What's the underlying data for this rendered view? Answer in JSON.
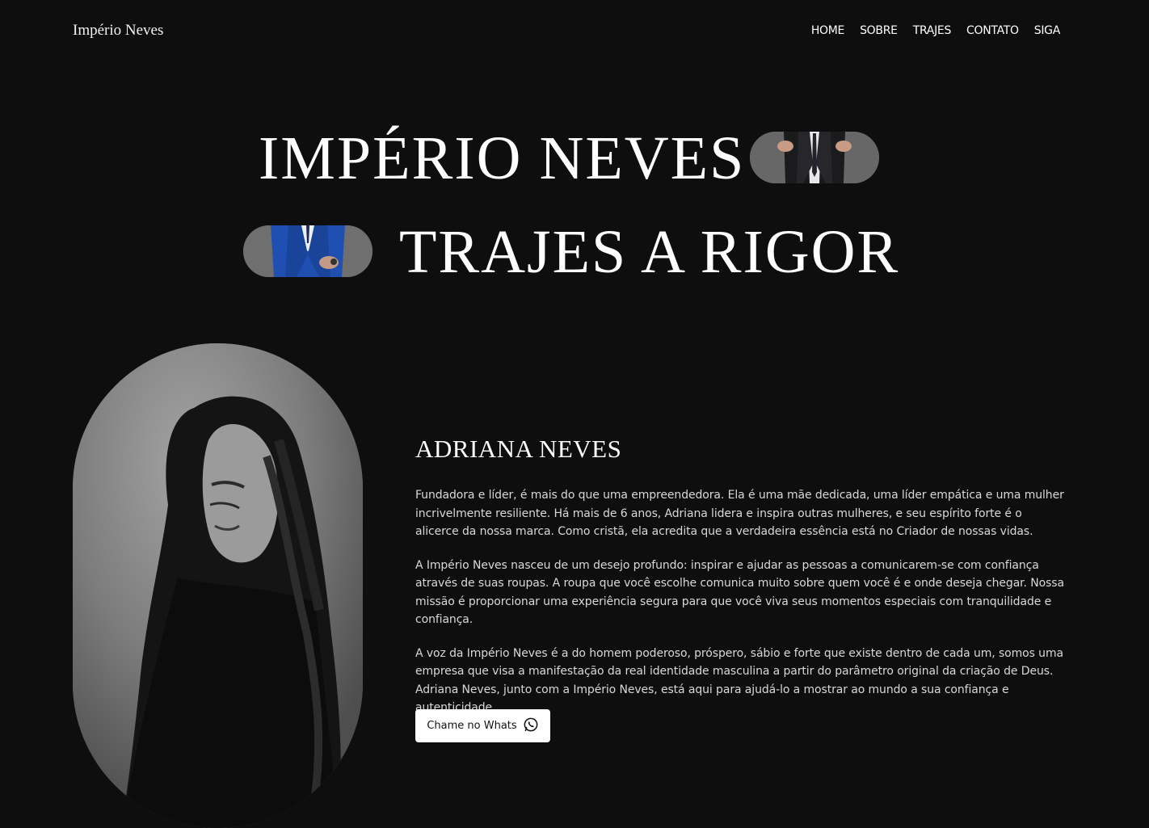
{
  "header": {
    "brand": "Império Neves",
    "nav": [
      "HOME",
      "SOBRE",
      "TRAJES",
      "CONTATO",
      "SIGA"
    ]
  },
  "hero": {
    "line1": "IMPÉRIO NEVES",
    "line2": "TRAJES A RIGOR"
  },
  "about": {
    "title": "ADRIANA NEVES",
    "paragraphs": [
      "Fundadora e líder, é mais do que uma empreendedora. Ela é uma mãe dedicada, uma líder empática e uma mulher incrivelmente resiliente. Há mais de 6 anos, Adriana lidera e inspira outras mulheres, e seu espírito forte é o alicerce da nossa marca. Como cristã, ela acredita que a verdadeira essência está no Criador de nossas vidas.",
      "A Império Neves nasceu de um desejo profundo: inspirar e ajudar as pessoas a comunicarem-se com confiança através de suas roupas. A roupa que você escolhe comunica muito sobre quem você é e onde deseja chegar. Nossa missão é proporcionar uma experiência segura para que você viva seus momentos especiais com tranquilidade e confiança.",
      "A voz da Império Neves é a do homem poderoso, próspero, sábio e forte que existe dentro de cada um, somos uma empresa que visa a manifestação da real identidade masculina a partir do parâmetro original da criação de Deus. Adriana Neves, junto com a Império Neves, está aqui para ajudá-lo a mostrar ao mundo a sua confiança e autenticidade."
    ],
    "cta_label": "Chame no Whats",
    "cta_icon": "whatsapp-icon"
  },
  "colors": {
    "background": "#0e0e0e",
    "text": "#f2f2f2",
    "button_bg": "#ffffff",
    "button_text": "#111111",
    "suit_blue": "#1f4fb0"
  }
}
